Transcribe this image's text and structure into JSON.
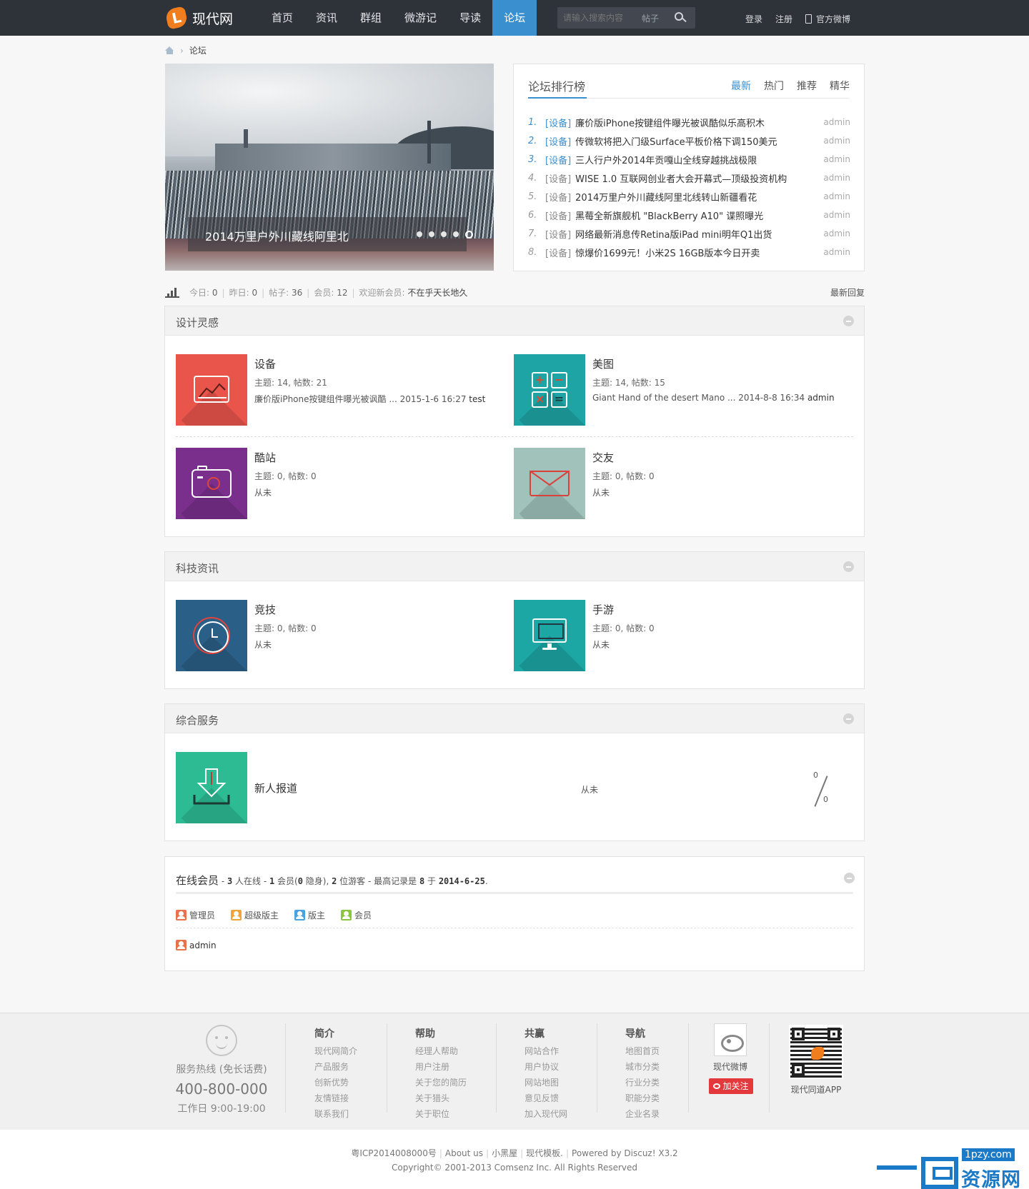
{
  "header": {
    "logo_text": "现代网",
    "nav": [
      "首页",
      "资讯",
      "群组",
      "微游记",
      "导读",
      "论坛"
    ],
    "search": {
      "placeholder": "请输入搜索内容",
      "type": "帖子"
    },
    "login": "登录",
    "register": "注册",
    "weibo": "官方微博"
  },
  "breadcrumb": {
    "current": "论坛"
  },
  "slider": {
    "caption": "2014万里户外川藏线阿里北",
    "dots": 5,
    "active_dot": 5
  },
  "ranking": {
    "title": "论坛排行榜",
    "tabs": [
      "最新",
      "热门",
      "推荐",
      "精华"
    ],
    "items": [
      {
        "num": "1.",
        "tag": "[设备]",
        "subject": "廉价版iPhone按键组件曝光被讽酷似乐高积木",
        "author": "admin"
      },
      {
        "num": "2.",
        "tag": "[设备]",
        "subject": "传微软将把入门级Surface平板价格下调150美元",
        "author": "admin"
      },
      {
        "num": "3.",
        "tag": "[设备]",
        "subject": "三人行户外2014年贡嘎山全线穿越挑战极限",
        "author": "admin"
      },
      {
        "num": "4.",
        "tag": "[设备]",
        "subject": "WISE 1.0 互联网创业者大会开幕式—顶级投资机构",
        "author": "admin"
      },
      {
        "num": "5.",
        "tag": "[设备]",
        "subject": "2014万里户外川藏线阿里北线转山新疆看花",
        "author": "admin"
      },
      {
        "num": "6.",
        "tag": "[设备]",
        "subject": "黑莓全新旗舰机 \"BlackBerry A10\" 谍照曝光",
        "author": "admin"
      },
      {
        "num": "7.",
        "tag": "[设备]",
        "subject": "网络最新消息传Retina版iPad mini明年Q1出货",
        "author": "admin"
      },
      {
        "num": "8.",
        "tag": "[设备]",
        "subject": "惊爆价1699元！小米2S 16GB版本今日开卖",
        "author": "admin"
      }
    ]
  },
  "stats": {
    "today_label": "今日:",
    "today": "0",
    "yesterday_label": "昨日:",
    "yesterday": "0",
    "posts_label": "帖子:",
    "posts": "36",
    "members_label": "会员:",
    "members": "12",
    "welcome_label": "欢迎新会员:",
    "newest_member": "不在乎天长地久",
    "latest_reply": "最新回复"
  },
  "groups": [
    {
      "title": "设计灵感",
      "forums": [
        {
          "name": "设备",
          "meta": "主题: 14, 帖数: 21",
          "last_title": "廉价版iPhone按键组件曝光被讽酷 ...",
          "last_time": "2015-1-6 16:27",
          "last_user": "test",
          "color": "#e9554a"
        },
        {
          "name": "美图",
          "meta": "主题: 14, 帖数: 15",
          "last_title": "Giant Hand of the desert Mano ...",
          "last_time": "2014-8-8 16:34",
          "last_user": "admin",
          "color": "#1fa4a5"
        },
        {
          "name": "酷站",
          "meta": "主题: 0, 帖数: 0",
          "last_title": "从未",
          "color": "#7a2f8c"
        },
        {
          "name": "交友",
          "meta": "主题: 0, 帖数: 0",
          "last_title": "从未",
          "color": "#a0c2bb"
        }
      ]
    },
    {
      "title": "科技资讯",
      "forums": [
        {
          "name": "竞技",
          "meta": "主题: 0, 帖数: 0",
          "last_title": "从未",
          "color": "#2a5f87"
        },
        {
          "name": "手游",
          "meta": "主题: 0, 帖数: 0",
          "last_title": "从未",
          "color": "#1ca6a4"
        }
      ]
    },
    {
      "title": "综合服务",
      "forums": [
        {
          "name": "新人报道",
          "last_title": "从未",
          "threads": "0",
          "posts": "0",
          "color": "#2dbb93"
        }
      ]
    }
  ],
  "online": {
    "title": "在线会员",
    "d1": " - ",
    "total": "3",
    "t1": " 人在线 - ",
    "members": "1",
    "t2": " 会员(",
    "hidden": "0",
    "t3": " 隐身), ",
    "guests": "2",
    "t4": " 位游客 - 最高记录是 ",
    "record": "8",
    "t5": " 于 ",
    "record_date": "2014-6-25",
    "t6": ".",
    "legend": [
      {
        "label": "管理员",
        "color": "#e8734a"
      },
      {
        "label": "超级版主",
        "color": "#f0a53a"
      },
      {
        "label": "版主",
        "color": "#4aa3df"
      },
      {
        "label": "会员",
        "color": "#8cc63f"
      }
    ],
    "list": [
      {
        "name": "admin",
        "color": "#e8734a"
      }
    ]
  },
  "footer": {
    "hotline_label": "服务热线 (免长话费)",
    "hotline": "400-800-000",
    "hours": "工作日 9:00-19:00",
    "columns": [
      {
        "title": "简介",
        "links": [
          "现代网简介",
          "产品服务",
          "创新优势",
          "友情链接",
          "联系我们"
        ]
      },
      {
        "title": "帮助",
        "links": [
          "经理人帮助",
          "用户注册",
          "关于您的简历",
          "关于猎头",
          "关于职位"
        ]
      },
      {
        "title": "共赢",
        "links": [
          "网站合作",
          "用户协议",
          "网站地图",
          "意见反馈",
          "加入现代网"
        ]
      },
      {
        "title": "导航",
        "links": [
          "地图首页",
          "城市分类",
          "行业分类",
          "职能分类",
          "企业名录"
        ]
      }
    ],
    "weibo_label": "现代微博",
    "follow": "加关注",
    "app_label": "现代同道APP"
  },
  "copyright": {
    "icp": "粤ICP2014008000号",
    "about": "About us",
    "xiaoheiwu": "小黑屋",
    "template": "现代模板.",
    "powered": "Powered by Discuz! X3.2",
    "line2": "Copyright© 2001-2013 Comsenz Inc. All Rights Reserved"
  },
  "watermark": {
    "url": "1pzy.com",
    "text": "资源网"
  }
}
